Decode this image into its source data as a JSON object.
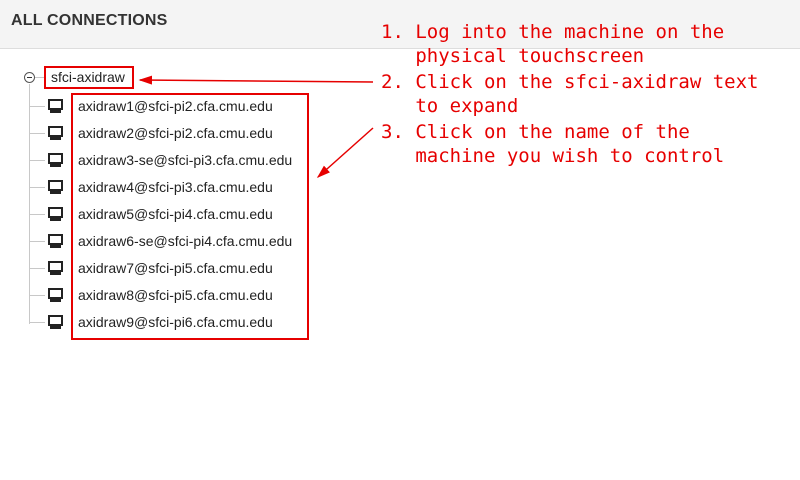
{
  "header": {
    "title": "ALL CONNECTIONS"
  },
  "group": {
    "label": "sfci-axidraw"
  },
  "connections": [
    {
      "label": "axidraw1@sfci-pi2.cfa.cmu.edu"
    },
    {
      "label": "axidraw2@sfci-pi2.cfa.cmu.edu"
    },
    {
      "label": "axidraw3-se@sfci-pi3.cfa.cmu.edu"
    },
    {
      "label": "axidraw4@sfci-pi3.cfa.cmu.edu"
    },
    {
      "label": "axidraw5@sfci-pi4.cfa.cmu.edu"
    },
    {
      "label": "axidraw6-se@sfci-pi4.cfa.cmu.edu"
    },
    {
      "label": "axidraw7@sfci-pi5.cfa.cmu.edu"
    },
    {
      "label": "axidraw8@sfci-pi5.cfa.cmu.edu"
    },
    {
      "label": "axidraw9@sfci-pi6.cfa.cmu.edu"
    }
  ],
  "annotations": {
    "step1": "1. Log into the machine on the\n   physical touchscreen",
    "step2": "2. Click on the sfci-axidraw text\n   to expand",
    "step3": "3. Click on the name of the\n   machine you wish to control"
  },
  "colors": {
    "annotation": "#e60000",
    "header_bg": "#f4f4f4"
  },
  "icons": {
    "group_toggle": "minus-circle-icon",
    "connection": "monitor-icon"
  }
}
